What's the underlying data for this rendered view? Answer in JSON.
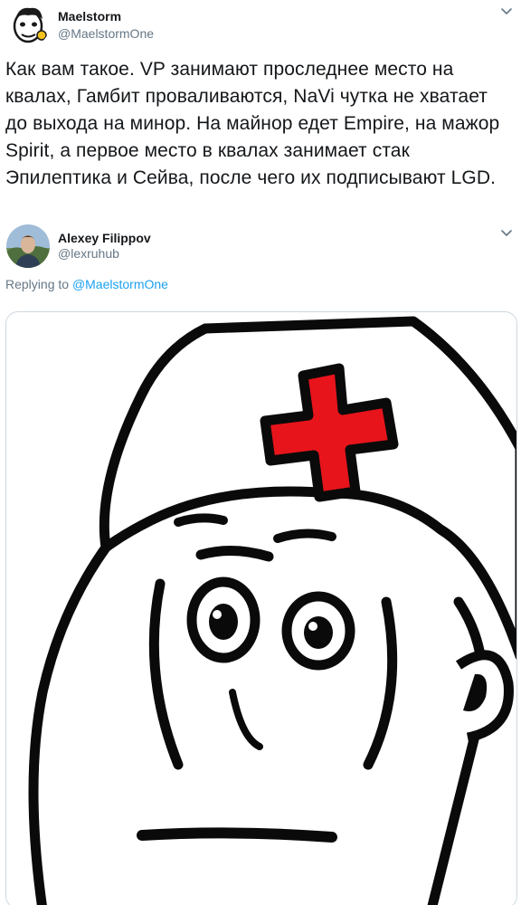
{
  "tweet": {
    "author_name": "Maelstorm",
    "author_handle": "@MaelstormOne",
    "text": "Как вам такое. VP занимают проследнее место на квалах, Гамбит проваливаются, NaVi чутка не хватает до выхода на минор. На майнор едет Empire, на мажор Spirit, а первое место в квалах занимает стак Эпилептика и Сейва, после чего их подписывают LGD."
  },
  "reply": {
    "author_name": "Alexey Filippov",
    "author_handle": "@lexruhub",
    "replying_prefix": "Replying to",
    "replying_handle": "@MaelstormOne"
  },
  "icons": {
    "menu": "chevron-down-icon",
    "avatar_first": "avatar",
    "avatar_reply": "avatar",
    "media": "doctor-meme-image"
  },
  "colors": {
    "text": "#14171a",
    "secondary": "#657786",
    "link": "#1da1f2",
    "border": "#ccd6dd",
    "cross": "#e8141b"
  }
}
